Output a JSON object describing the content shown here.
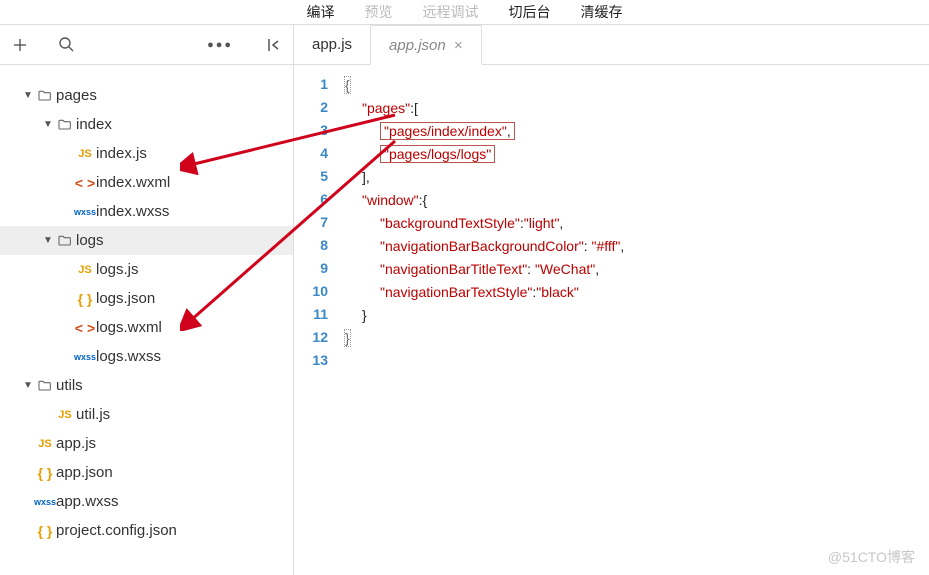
{
  "topbar": {
    "compile": "编译",
    "preview": "预览",
    "remote": "远程调试",
    "back": "切后台",
    "clean": "清缓存"
  },
  "tree": {
    "pages": "pages",
    "index": "index",
    "index_js": "index.js",
    "index_wxml": "index.wxml",
    "index_wxss": "index.wxss",
    "logs": "logs",
    "logs_js": "logs.js",
    "logs_json": "logs.json",
    "logs_wxml": "logs.wxml",
    "logs_wxss": "logs.wxss",
    "utils": "utils",
    "util_js": "util.js",
    "app_js": "app.js",
    "app_json": "app.json",
    "app_wxss": "app.wxss",
    "project_config": "project.config.json"
  },
  "tabs": {
    "t1": "app.js",
    "t2": "app.json"
  },
  "code": {
    "pages_key": "\"pages\"",
    "page1": "\"pages/index/index\"",
    "page2": "\"pages/logs/logs\"",
    "window_key": "\"window\"",
    "bts_key": "\"backgroundTextStyle\"",
    "bts_val": "\"light\"",
    "nbbc_key": "\"navigationBarBackgroundColor\"",
    "nbbc_val": "\"#fff\"",
    "nbtt_key": "\"navigationBarTitleText\"",
    "nbtt_val": "\"WeChat\"",
    "nbts_key": "\"navigationBarTextStyle\"",
    "nbts_val": "\"black\""
  },
  "watermark": "@51CTO博客"
}
